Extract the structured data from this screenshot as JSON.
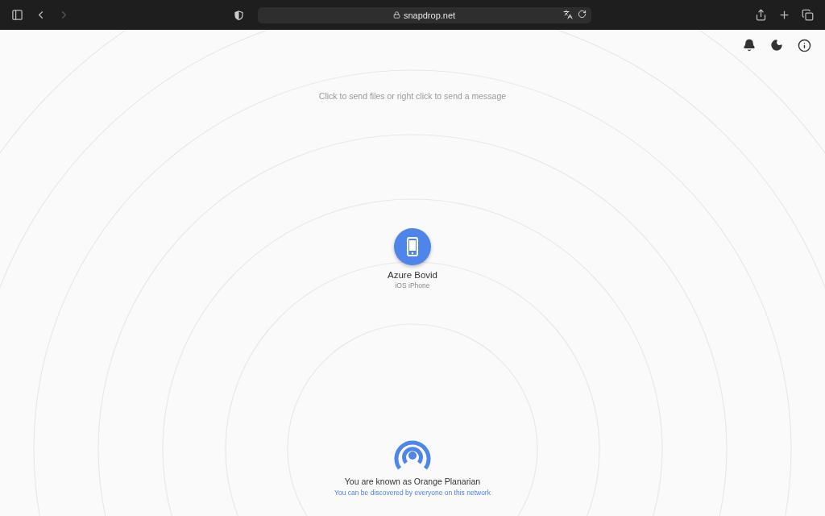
{
  "browser": {
    "url": "snapdrop.net"
  },
  "hint": "Click to send files or right click to send a message",
  "peers": [
    {
      "name": "Azure Bovid",
      "device": "iOS iPhone"
    }
  ],
  "footer": {
    "known_as": "You are known as Orange Planarian",
    "discover": "You can be discovered by everyone on this network"
  }
}
